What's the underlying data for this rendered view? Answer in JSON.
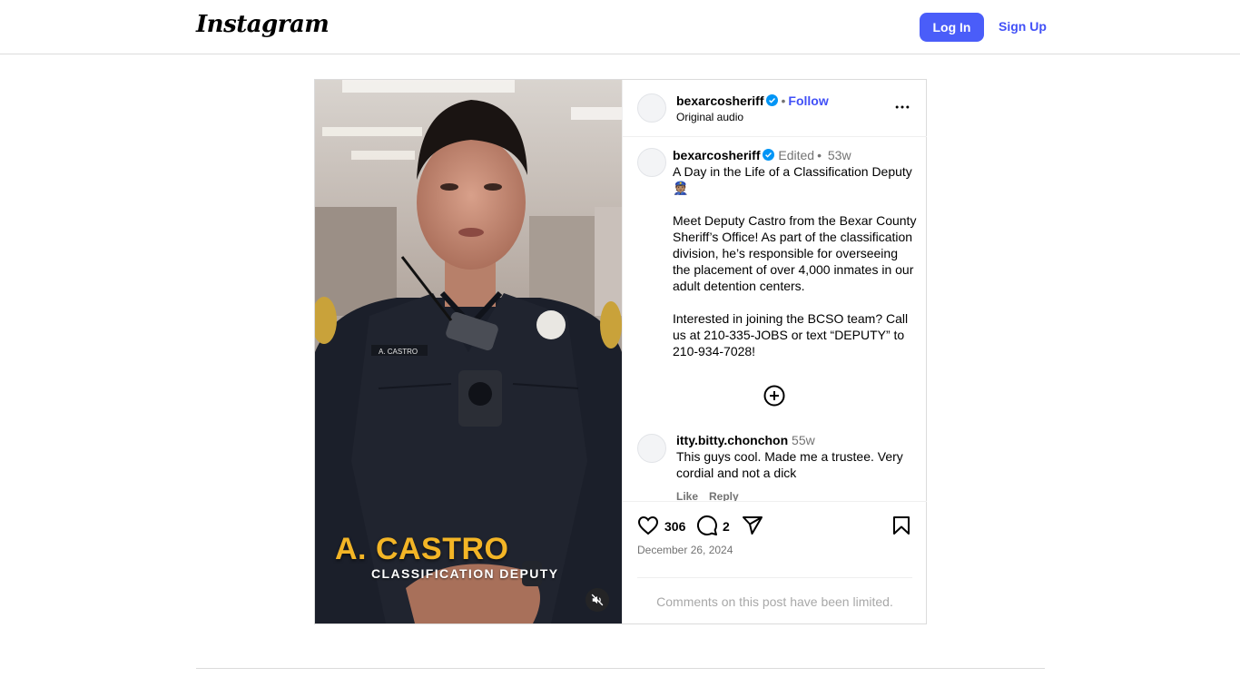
{
  "nav": {
    "logo": "Instagram",
    "login_label": "Log In",
    "signup_label": "Sign Up"
  },
  "post": {
    "username": "bexarcosheriff",
    "follow_label": "Follow",
    "audio": "Original audio",
    "separator": "•",
    "overlay": {
      "name": "A. CASTRO",
      "role": "CLASSIFICATION DEPUTY"
    },
    "caption": {
      "username": "bexarcosheriff",
      "edited": "Edited",
      "time": "53w",
      "paragraphs": [
        "A Day in the Life of a Classification Deputy 👮🏽",
        "Meet Deputy Castro from the Bexar County Sheriff’s Office! As part of the classification division, he’s responsible for overseeing the placement of over 4,000 inmates in our adult detention centers.",
        "Interested in joining the BCSO team? Call us at 210-335-JOBS or text “DEPUTY” to 210-934-7028!"
      ]
    },
    "comment": {
      "username": "itty.bitty.chonchon",
      "time": "55w",
      "text": "This guys cool. Made me a trustee. Very cordial and not a dick",
      "like_label": "Like",
      "reply_label": "Reply"
    },
    "likes": "306",
    "comments_count": "2",
    "date": "December 26, 2024",
    "limited_notice": "Comments on this post have been limited."
  },
  "colors": {
    "accent": "#4a5df9",
    "link": "#4150f7",
    "verified": "#0095f6",
    "overlay_name": "#f3b526"
  }
}
